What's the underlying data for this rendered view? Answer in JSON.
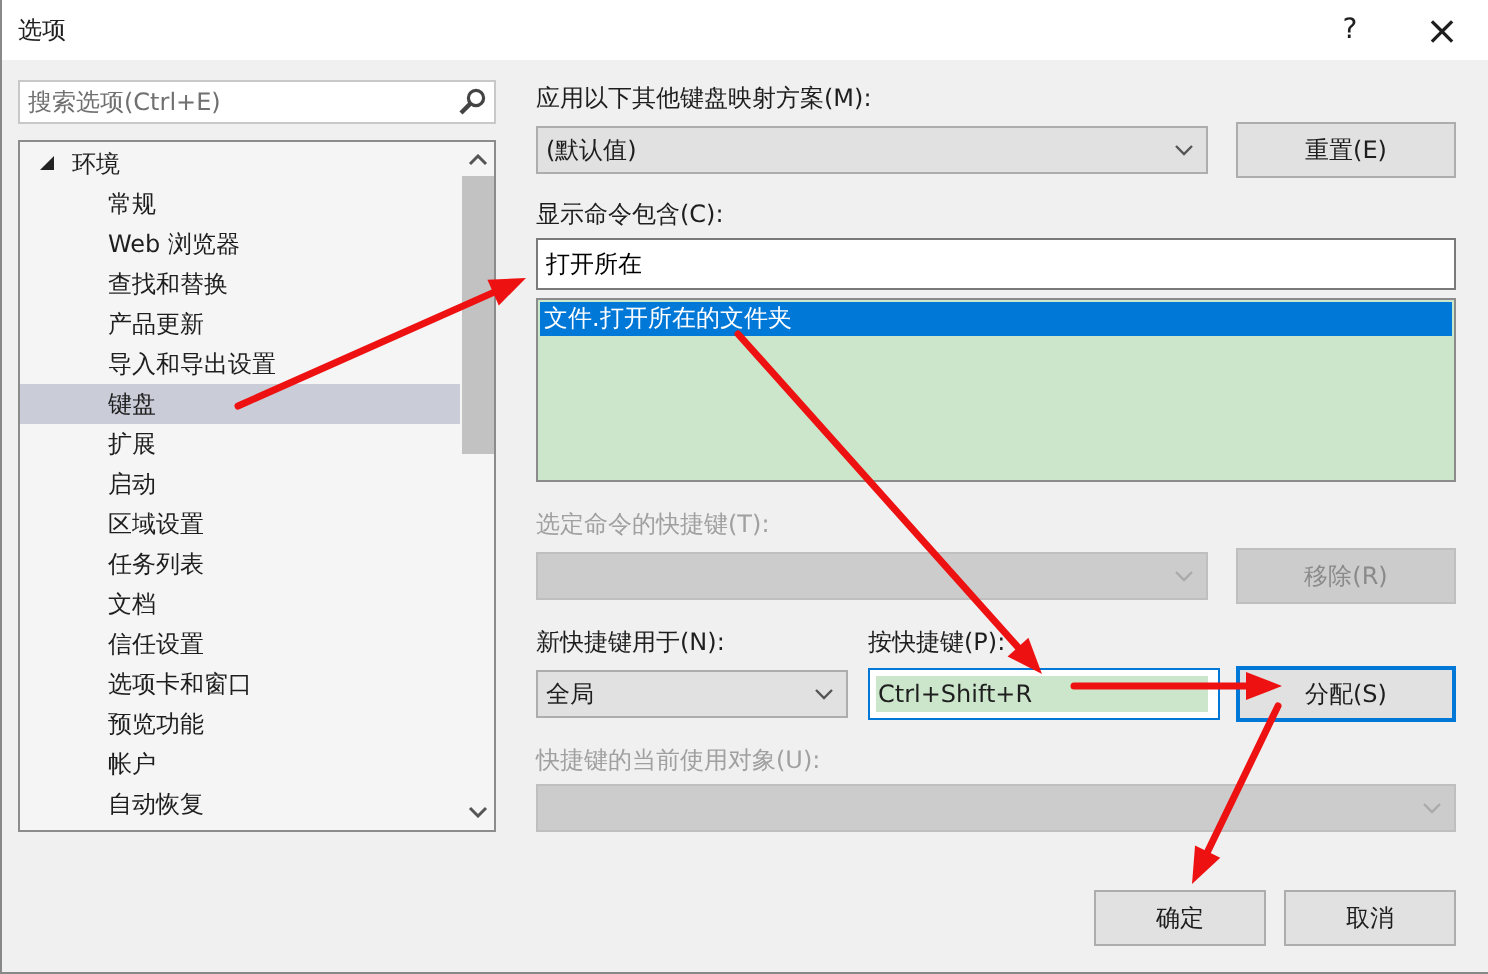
{
  "window": {
    "title": "选项",
    "help_button": "?",
    "close_button": "×"
  },
  "search": {
    "placeholder": "搜索选项(Ctrl+E)"
  },
  "tree": [
    {
      "label": "环境",
      "expanded": true,
      "selected": false,
      "children": [
        {
          "label": "常规",
          "selected": false
        },
        {
          "label": "Web 浏览器",
          "selected": false
        },
        {
          "label": "查找和替换",
          "selected": false
        },
        {
          "label": "产品更新",
          "selected": false
        },
        {
          "label": "导入和导出设置",
          "selected": false
        },
        {
          "label": "键盘",
          "selected": true
        },
        {
          "label": "扩展",
          "selected": false
        },
        {
          "label": "启动",
          "selected": false
        },
        {
          "label": "区域设置",
          "selected": false
        },
        {
          "label": "任务列表",
          "selected": false
        },
        {
          "label": "文档",
          "selected": false
        },
        {
          "label": "信任设置",
          "selected": false
        },
        {
          "label": "选项卡和窗口",
          "selected": false
        },
        {
          "label": "预览功能",
          "selected": false
        },
        {
          "label": "帐户",
          "selected": false
        },
        {
          "label": "自动恢复",
          "selected": false
        }
      ]
    }
  ],
  "keyboard_scheme": {
    "label": "应用以下其他键盘映射方案(M):",
    "value": "(默认值)",
    "button": "重置(E)"
  },
  "command_filter": {
    "label": "显示命令包含(C):",
    "value": "打开所在"
  },
  "commands": [
    {
      "label": "文件.打开所在的文件夹",
      "selected": true
    }
  ],
  "current_shortcuts": {
    "label": "选定命令的快捷键(T):",
    "disabled": true,
    "button": "移除(R)"
  },
  "new_shortcut": {
    "scope_label": "新快捷键用于(N):",
    "scope_value": "全局",
    "keys_label": "按快捷键(P):",
    "keys_value": "Ctrl+Shift+R",
    "assign_button": "分配(S)",
    "assign_focused": true
  },
  "used_by": {
    "label": "快捷键的当前使用对象(U):",
    "disabled": true
  },
  "buttons": [
    {
      "label": "确定"
    },
    {
      "label": "取消"
    }
  ]
}
